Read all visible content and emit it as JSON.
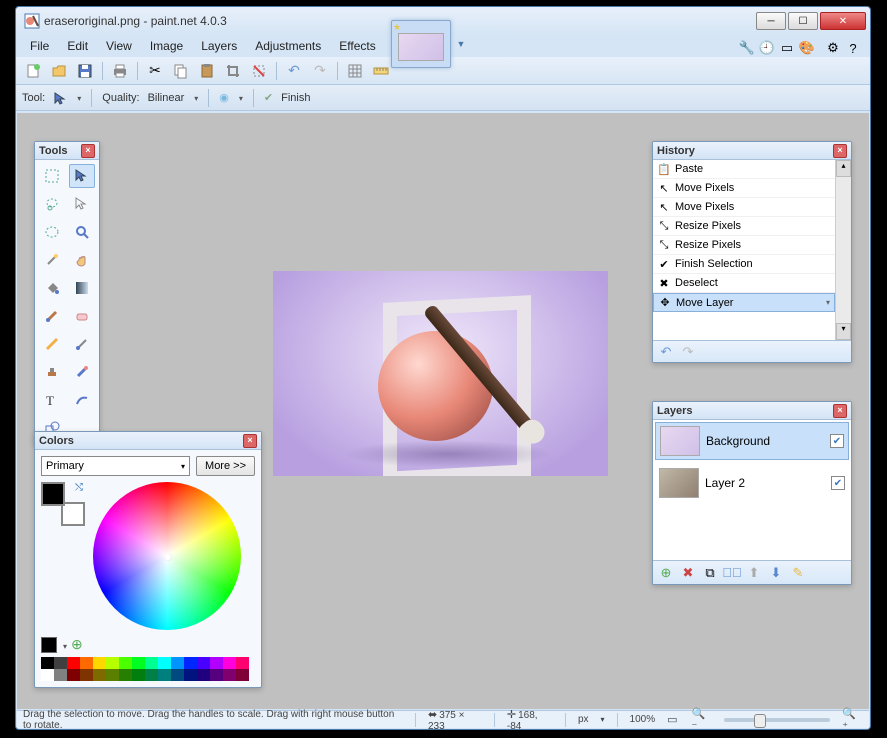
{
  "window": {
    "title": "eraseroriginal.png - paint.net 4.0.3"
  },
  "menu": [
    "File",
    "Edit",
    "View",
    "Image",
    "Layers",
    "Adjustments",
    "Effects"
  ],
  "option_bar": {
    "tool_label": "Tool:",
    "quality_label": "Quality:",
    "quality_value": "Bilinear",
    "finish_label": "Finish"
  },
  "panels": {
    "tools_title": "Tools",
    "history_title": "History",
    "layers_title": "Layers",
    "colors_title": "Colors"
  },
  "history": {
    "items": [
      {
        "icon": "paste",
        "label": "Paste"
      },
      {
        "icon": "move",
        "label": "Move Pixels"
      },
      {
        "icon": "move",
        "label": "Move Pixels"
      },
      {
        "icon": "resize",
        "label": "Resize Pixels"
      },
      {
        "icon": "resize",
        "label": "Resize Pixels"
      },
      {
        "icon": "finish",
        "label": "Finish Selection"
      },
      {
        "icon": "deselect",
        "label": "Deselect"
      },
      {
        "icon": "movelayer",
        "label": "Move Layer"
      }
    ],
    "selected_index": 7
  },
  "layers": {
    "items": [
      {
        "name": "Background",
        "visible": true,
        "selected": true
      },
      {
        "name": "Layer 2",
        "visible": true,
        "selected": false
      }
    ]
  },
  "colors": {
    "mode": "Primary",
    "more_label": "More >>",
    "foreground": "#000000",
    "background": "#ffffff",
    "palette": [
      "#000000",
      "#404040",
      "#ff0000",
      "#ff6a00",
      "#ffd800",
      "#b6ff00",
      "#4cff00",
      "#00ff21",
      "#00ff90",
      "#00ffff",
      "#0094ff",
      "#0026ff",
      "#4800ff",
      "#b200ff",
      "#ff00dc",
      "#ff006e",
      "#ffffff",
      "#808080",
      "#7f0000",
      "#7f3300",
      "#7f6a00",
      "#5b7f00",
      "#267f00",
      "#007f0e",
      "#007f46",
      "#007f7f",
      "#004a7f",
      "#00137f",
      "#21007f",
      "#57007f",
      "#7f006e",
      "#7f0037"
    ]
  },
  "status": {
    "hint": "Drag the selection to move. Drag the handles to scale. Drag with right mouse button to rotate.",
    "image_size": "375 × 233",
    "cursor_pos": "168, -84",
    "unit": "px",
    "zoom": "100%"
  }
}
